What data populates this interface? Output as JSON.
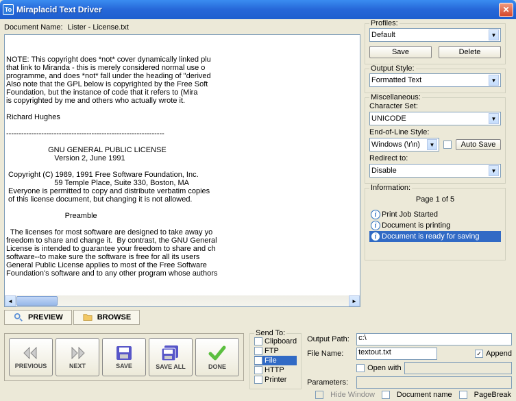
{
  "window": {
    "title": "Miraplacid Text Driver"
  },
  "document": {
    "label": "Document Name:",
    "name": "Lister - License.txt"
  },
  "text_content": "NOTE: This copyright does *not* cover dynamically linked plu\nthat link to Miranda - this is merely considered normal use o\nprogramme, and does *not* fall under the heading of \"derived\nAlso note that the GPL below is copyrighted by the Free Soft\nFoundation, but the instance of code that it refers to (Mira\nis copyrighted by me and others who actually wrote it.\n\nRichard Hughes\n\n---------------------------------------------------------------\n\n                    GNU GENERAL PUBLIC LICENSE\n                       Version 2, June 1991\n\n Copyright (C) 1989, 1991 Free Software Foundation, Inc.\n                       59 Temple Place, Suite 330, Boston, MA\n Everyone is permitted to copy and distribute verbatim copies\n of this license document, but changing it is not allowed.\n\n                            Preamble\n\n  The licenses for most software are designed to take away yo\nfreedom to share and change it.  By contrast, the GNU General\nLicense is intended to guarantee your freedom to share and ch\nsoftware--to make sure the software is free for all its users\nGeneral Public License applies to most of the Free Software\nFoundation's software and to any other program whose authors ",
  "profiles": {
    "legend": "Profiles:",
    "value": "Default",
    "save": "Save",
    "delete": "Delete"
  },
  "output_style": {
    "legend": "Output Style:",
    "value": "Formatted Text"
  },
  "misc": {
    "legend": "Miscellaneous:",
    "charset_label": "Character Set:",
    "charset_value": "UNICODE",
    "eol_label": "End-of-Line Style:",
    "eol_value": "Windows (\\r\\n)",
    "autosave": "Auto Save",
    "redirect_label": "Redirect to:",
    "redirect_value": "Disable"
  },
  "info": {
    "legend": "Information:",
    "page": "Page 1 of 5",
    "items": [
      {
        "text": "Print Job Started",
        "selected": false
      },
      {
        "text": "Document is printing",
        "selected": false
      },
      {
        "text": "Document is ready for saving",
        "selected": true
      }
    ]
  },
  "tabs": {
    "preview": "PREVIEW",
    "browse": "BROWSE"
  },
  "bigbuttons": {
    "previous": "PREVIOUS",
    "next": "NEXT",
    "save": "SAVE",
    "saveall": "SAVE ALL",
    "done": "DONE"
  },
  "sendto": {
    "legend": "Send To:",
    "items": [
      {
        "label": "Clipboard",
        "checked": false,
        "selected": false
      },
      {
        "label": "FTP",
        "checked": false,
        "selected": false
      },
      {
        "label": "File",
        "checked": true,
        "selected": true
      },
      {
        "label": "HTTP",
        "checked": false,
        "selected": false
      },
      {
        "label": "Printer",
        "checked": false,
        "selected": false
      }
    ]
  },
  "output": {
    "path_label": "Output Path:",
    "path_value": "c:\\",
    "filename_label": "File Name:",
    "filename_value": "textout.txt",
    "append": "Append",
    "openwith": "Open with",
    "params_label": "Parameters:",
    "hidewindow": "Hide Window",
    "docname": "Document name",
    "pagebreak": "PageBreak"
  }
}
